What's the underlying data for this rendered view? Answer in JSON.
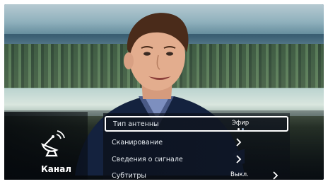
{
  "sidebar": {
    "label": "Канал",
    "icon": "satellite-dish-icon"
  },
  "menu": {
    "items": [
      {
        "label": "Тип антенны",
        "value": "Эфир",
        "selected": true
      },
      {
        "label": "Сканирование",
        "value": "",
        "selected": false
      },
      {
        "label": "Сведения о сигнале",
        "value": "",
        "selected": false
      },
      {
        "label": "Субтитры",
        "value": "Выкл.",
        "selected": false
      }
    ]
  },
  "colors": {
    "selection_border": "#ffffff",
    "menu_text": "#e8edf2"
  }
}
